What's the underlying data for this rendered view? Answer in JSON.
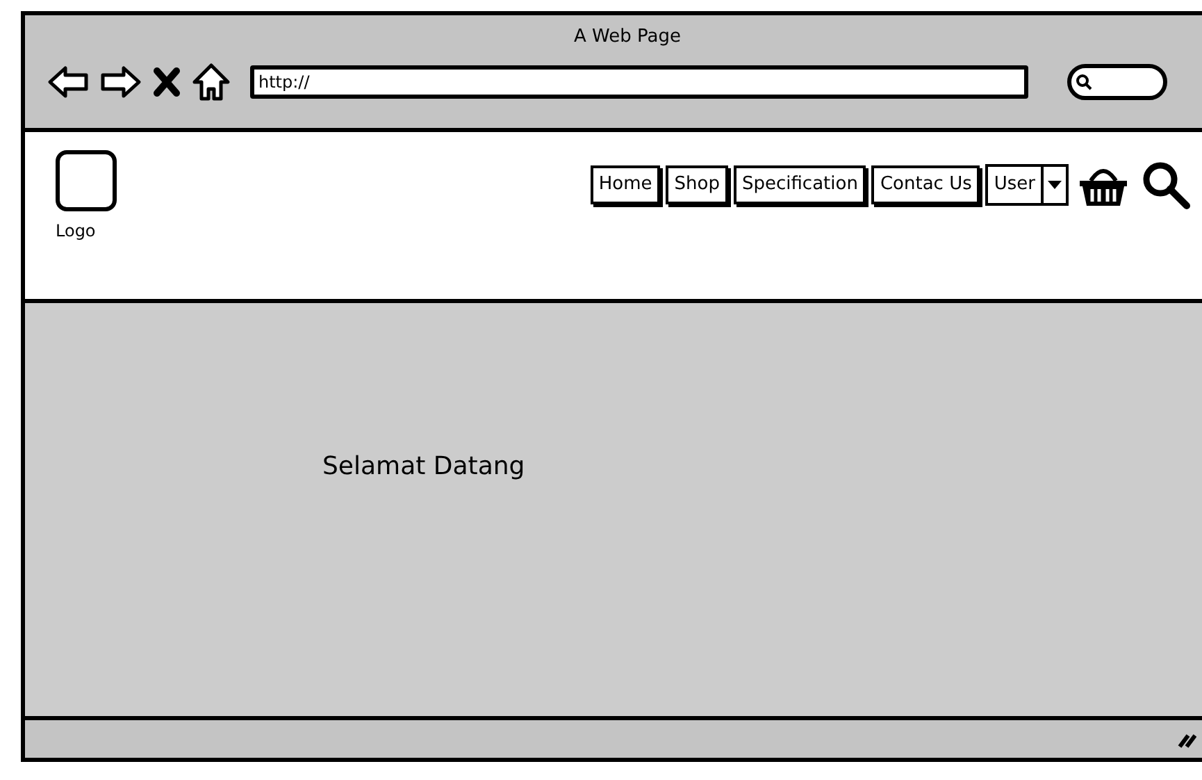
{
  "window": {
    "title": "A Web Page"
  },
  "address_bar": {
    "value": "http://"
  },
  "header": {
    "logo_label": "Logo",
    "nav": [
      {
        "label": "Home"
      },
      {
        "label": "Shop"
      },
      {
        "label": "Specification"
      },
      {
        "label": "Contac Us"
      }
    ],
    "user_menu": {
      "label": "User"
    }
  },
  "content": {
    "heading": "Selamat Datang"
  }
}
